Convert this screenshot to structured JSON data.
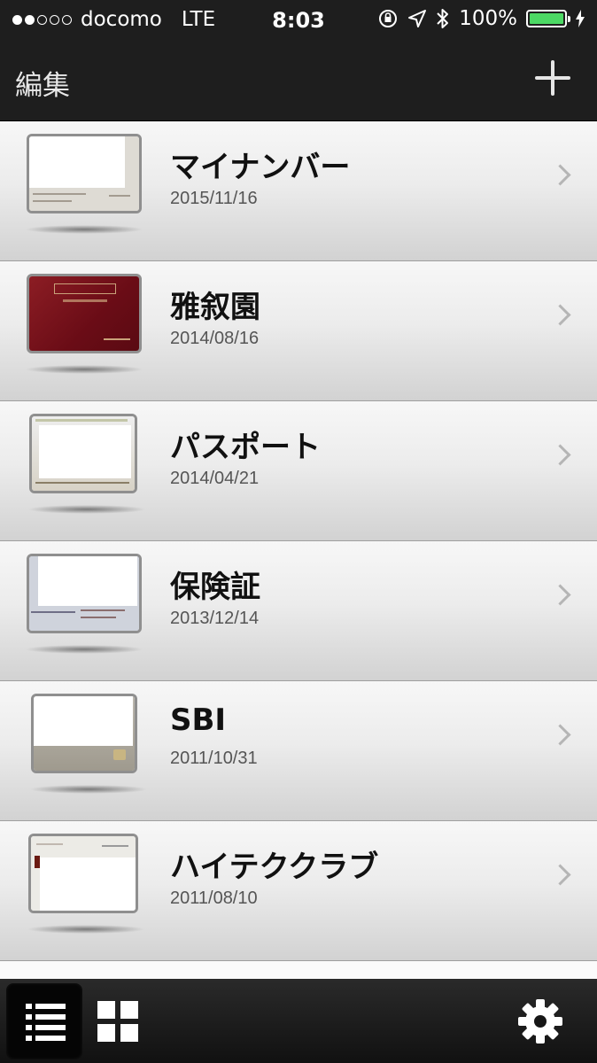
{
  "status_bar": {
    "carrier": "docomo",
    "network": "LTE",
    "time": "8:03",
    "battery": "100%",
    "battery_level": 1.0,
    "signal_bars_filled": 2,
    "signal_bars_total": 5
  },
  "nav": {
    "edit_label": "編集",
    "add_icon": "plus-icon"
  },
  "items": [
    {
      "title": "マイナンバー",
      "date": "2015/11/16"
    },
    {
      "title": "雅叙園",
      "date": "2014/08/16"
    },
    {
      "title": "パスポート",
      "date": "2014/04/21"
    },
    {
      "title": "保険証",
      "date": "2013/12/14"
    },
    {
      "title": "SBI",
      "date": "2011/10/31"
    },
    {
      "title": "ハイテククラブ",
      "date": "2011/08/10"
    }
  ],
  "tab_bar": {
    "list_icon": "list-view-icon",
    "grid_icon": "grid-view-icon",
    "settings_icon": "gear-icon"
  },
  "colors": {
    "bar_background": "#1e1e1e",
    "battery_fill": "#4cd964",
    "row_gradient_top": "#f7f7f7",
    "row_gradient_bottom": "#d2d2d2"
  }
}
